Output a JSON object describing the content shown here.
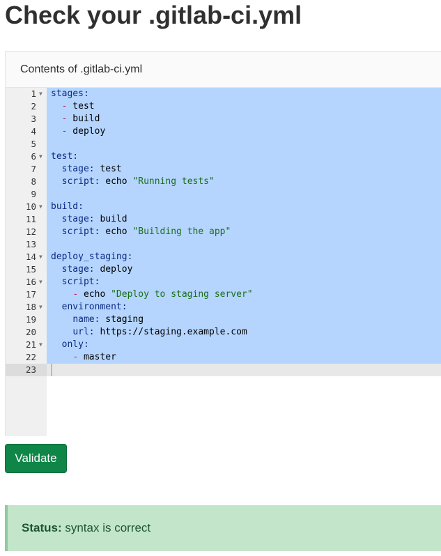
{
  "page_title": "Check your .gitlab-ci.yml",
  "panel": {
    "header": "Contents of .gitlab-ci.yml"
  },
  "editor": {
    "lines": [
      {
        "n": "1",
        "fold": true,
        "tokens": [
          {
            "t": "k",
            "v": "stages:"
          }
        ]
      },
      {
        "n": "2",
        "fold": false,
        "tokens": [
          {
            "t": "v",
            "v": "  "
          },
          {
            "t": "d",
            "v": "-"
          },
          {
            "t": "v",
            "v": " test"
          }
        ]
      },
      {
        "n": "3",
        "fold": false,
        "tokens": [
          {
            "t": "v",
            "v": "  "
          },
          {
            "t": "d",
            "v": "-"
          },
          {
            "t": "v",
            "v": " build"
          }
        ]
      },
      {
        "n": "4",
        "fold": false,
        "tokens": [
          {
            "t": "v",
            "v": "  "
          },
          {
            "t": "d",
            "v": "-"
          },
          {
            "t": "v",
            "v": " deploy"
          }
        ]
      },
      {
        "n": "5",
        "fold": false,
        "tokens": []
      },
      {
        "n": "6",
        "fold": true,
        "tokens": [
          {
            "t": "k",
            "v": "test:"
          }
        ]
      },
      {
        "n": "7",
        "fold": false,
        "tokens": [
          {
            "t": "v",
            "v": "  "
          },
          {
            "t": "k",
            "v": "stage:"
          },
          {
            "t": "v",
            "v": " test"
          }
        ]
      },
      {
        "n": "8",
        "fold": false,
        "tokens": [
          {
            "t": "v",
            "v": "  "
          },
          {
            "t": "k",
            "v": "script:"
          },
          {
            "t": "v",
            "v": " echo "
          },
          {
            "t": "s",
            "v": "\"Running tests\""
          }
        ]
      },
      {
        "n": "9",
        "fold": false,
        "tokens": []
      },
      {
        "n": "10",
        "fold": true,
        "tokens": [
          {
            "t": "k",
            "v": "build:"
          }
        ]
      },
      {
        "n": "11",
        "fold": false,
        "tokens": [
          {
            "t": "v",
            "v": "  "
          },
          {
            "t": "k",
            "v": "stage:"
          },
          {
            "t": "v",
            "v": " build"
          }
        ]
      },
      {
        "n": "12",
        "fold": false,
        "tokens": [
          {
            "t": "v",
            "v": "  "
          },
          {
            "t": "k",
            "v": "script:"
          },
          {
            "t": "v",
            "v": " echo "
          },
          {
            "t": "s",
            "v": "\"Building the app\""
          }
        ]
      },
      {
        "n": "13",
        "fold": false,
        "tokens": []
      },
      {
        "n": "14",
        "fold": true,
        "tokens": [
          {
            "t": "k",
            "v": "deploy_staging:"
          }
        ]
      },
      {
        "n": "15",
        "fold": false,
        "tokens": [
          {
            "t": "v",
            "v": "  "
          },
          {
            "t": "k",
            "v": "stage:"
          },
          {
            "t": "v",
            "v": " deploy"
          }
        ]
      },
      {
        "n": "16",
        "fold": true,
        "tokens": [
          {
            "t": "v",
            "v": "  "
          },
          {
            "t": "k",
            "v": "script:"
          }
        ]
      },
      {
        "n": "17",
        "fold": false,
        "tokens": [
          {
            "t": "v",
            "v": "    "
          },
          {
            "t": "d",
            "v": "-"
          },
          {
            "t": "v",
            "v": " echo "
          },
          {
            "t": "s",
            "v": "\"Deploy to staging server\""
          }
        ]
      },
      {
        "n": "18",
        "fold": true,
        "tokens": [
          {
            "t": "v",
            "v": "  "
          },
          {
            "t": "k",
            "v": "environment:"
          }
        ]
      },
      {
        "n": "19",
        "fold": false,
        "tokens": [
          {
            "t": "v",
            "v": "    "
          },
          {
            "t": "k",
            "v": "name:"
          },
          {
            "t": "v",
            "v": " staging"
          }
        ]
      },
      {
        "n": "20",
        "fold": false,
        "tokens": [
          {
            "t": "v",
            "v": "    "
          },
          {
            "t": "k",
            "v": "url:"
          },
          {
            "t": "v",
            "v": " https://staging.example.com"
          }
        ]
      },
      {
        "n": "21",
        "fold": true,
        "tokens": [
          {
            "t": "v",
            "v": "  "
          },
          {
            "t": "k",
            "v": "only:"
          }
        ]
      },
      {
        "n": "22",
        "fold": false,
        "tokens": [
          {
            "t": "v",
            "v": "    "
          },
          {
            "t": "d",
            "v": "-"
          },
          {
            "t": "v",
            "v": " master"
          }
        ]
      },
      {
        "n": "23",
        "fold": false,
        "tokens": []
      }
    ],
    "active_line": "23"
  },
  "validate_button": {
    "label": "Validate"
  },
  "status": {
    "label": "Status:",
    "text": " syntax is correct"
  },
  "colors": {
    "selection": "#b5d5ff",
    "key": "#0b2a82",
    "dash": "#b21d5c",
    "string": "#1a6e1a",
    "button": "#108548",
    "status_bg": "#c3e6cb"
  }
}
